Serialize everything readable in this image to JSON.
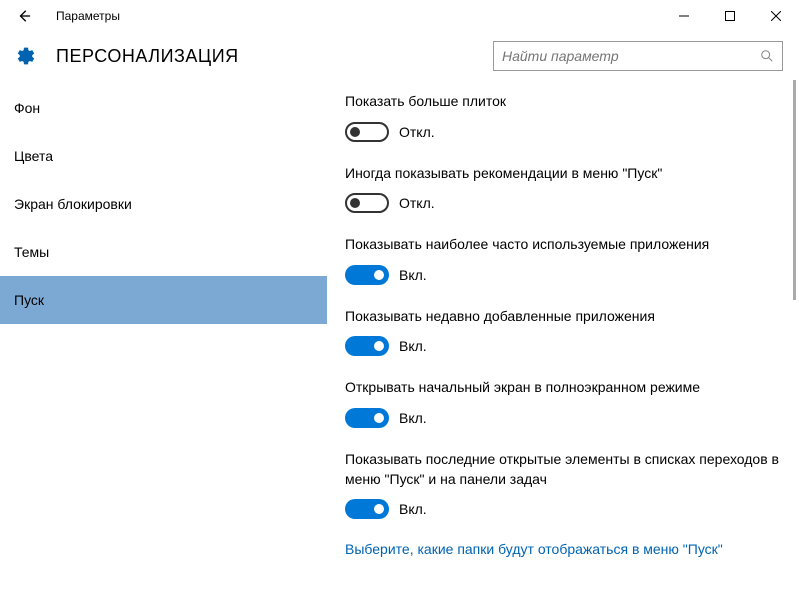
{
  "window": {
    "title": "Параметры"
  },
  "header": {
    "title": "ПЕРСОНАЛИЗАЦИЯ",
    "search_placeholder": "Найти параметр"
  },
  "sidebar": {
    "items": [
      {
        "label": "Фон"
      },
      {
        "label": "Цвета"
      },
      {
        "label": "Экран блокировки"
      },
      {
        "label": "Темы"
      },
      {
        "label": "Пуск"
      }
    ]
  },
  "settings": {
    "items": [
      {
        "label": "Показать больше плиток",
        "on": false
      },
      {
        "label": "Иногда показывать рекомендации в меню \"Пуск\"",
        "on": false
      },
      {
        "label": "Показывать наиболее часто используемые приложения",
        "on": true
      },
      {
        "label": "Показывать недавно добавленные приложения",
        "on": true
      },
      {
        "label": "Открывать начальный экран в полноэкранном режиме",
        "on": true
      },
      {
        "label": "Показывать последние открытые элементы в списках переходов в меню \"Пуск\" и на панели задач",
        "on": true
      }
    ],
    "state_on": "Вкл.",
    "state_off": "Откл.",
    "link_text": "Выберите, какие папки будут отображаться в меню \"Пуск\""
  }
}
